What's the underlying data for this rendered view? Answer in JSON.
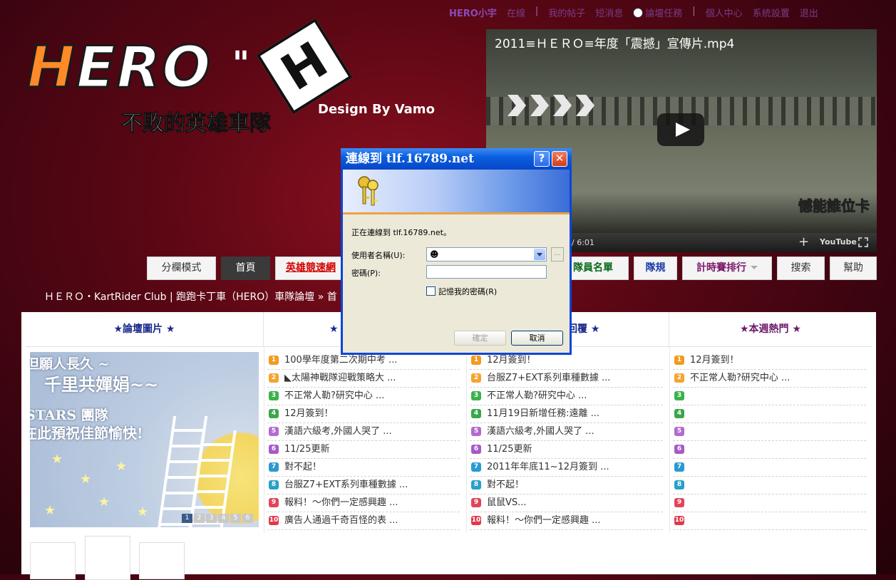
{
  "topnav": {
    "username": "HERO小宇",
    "items": [
      "在線",
      "我的帖子",
      "短消息",
      "論壇任務",
      "個人中心",
      "系統設置",
      "退出"
    ],
    "separator": "|"
  },
  "logo": {
    "hero_first": "H",
    "hero_rest": "ERO",
    "quote": "\"",
    "h_letter": "H",
    "subtitle": "不敗的英雄車隊",
    "design": "Design By Vamo"
  },
  "video": {
    "title": "2011≡ＨＥＲＯ≡年度「震撼」宣傳片.mp4",
    "caption": "憾能誰位卡",
    "time": "/ 6:01",
    "youtube": "YouTube",
    "plus": "+"
  },
  "menu": {
    "items": [
      {
        "label": "分欄模式"
      },
      {
        "label": "首頁"
      },
      {
        "label": "英雄競速網"
      },
      {
        "label": "隊員名單"
      },
      {
        "label": "隊規"
      },
      {
        "label": "計時賽排行"
      },
      {
        "label": "搜索"
      },
      {
        "label": "幫助"
      }
    ]
  },
  "breadcrumb": "ＨＥＲＯ・KartRider Club | 跑跑卡丁車（HERO）車隊論壇 » 首",
  "panel": {
    "headers": [
      "★論壇圖片 ★",
      "★",
      "回覆 ★",
      "★本週熱門 ★"
    ],
    "slide": {
      "line1": "但願人長久 ~",
      "line2": "千里共嬋娟~~",
      "line3": "STARS 團隊",
      "line4": "在此預祝佳節愉快!",
      "pages": [
        "1",
        "2",
        "3",
        "4",
        "5",
        "6"
      ]
    },
    "col2": [
      "100學年度第二次期中考 ...",
      "◣太陽神戰隊迎戰策略大 ...",
      "不正常人勒?研究中心 ...",
      "12月簽到！",
      "漢語六級考,外國人哭了 ...",
      "11/25更新",
      "對不起！",
      "台服Z7+EXT系列車種數據 ...",
      "報料！～你們一定感興趣 ...",
      "廣告人通過千奇百怪的表 ..."
    ],
    "col3": [
      "12月簽到！",
      "台服Z7+EXT系列車種數據 ...",
      "不正常人勒?研究中心 ...",
      "11月19日新增任務:遠離 ...",
      "漢語六級考,外國人哭了 ...",
      "11/25更新",
      "2011年年底11~12月簽到 ...",
      "對不起！",
      "鼠鼠VS...",
      "報料！～你們一定感興趣 ..."
    ],
    "col4": [
      "12月簽到！",
      "不正常人勒?研究中心 ...",
      "",
      "",
      "",
      "",
      "",
      "",
      "",
      ""
    ],
    "nums": [
      "1",
      "2",
      "3",
      "4",
      "5",
      "6",
      "7",
      "8",
      "9",
      "10"
    ]
  },
  "dialog": {
    "title": "連線到 tlf.16789.net",
    "help": "?",
    "close": "✕",
    "message": "正在連線到 tlf.16789.net。",
    "user_label": "使用者名稱(U):",
    "pass_label": "密碼(P):",
    "remember": "記憶我的密碼(R)",
    "browse": "...",
    "ok": "確定",
    "cancel": "取消"
  }
}
